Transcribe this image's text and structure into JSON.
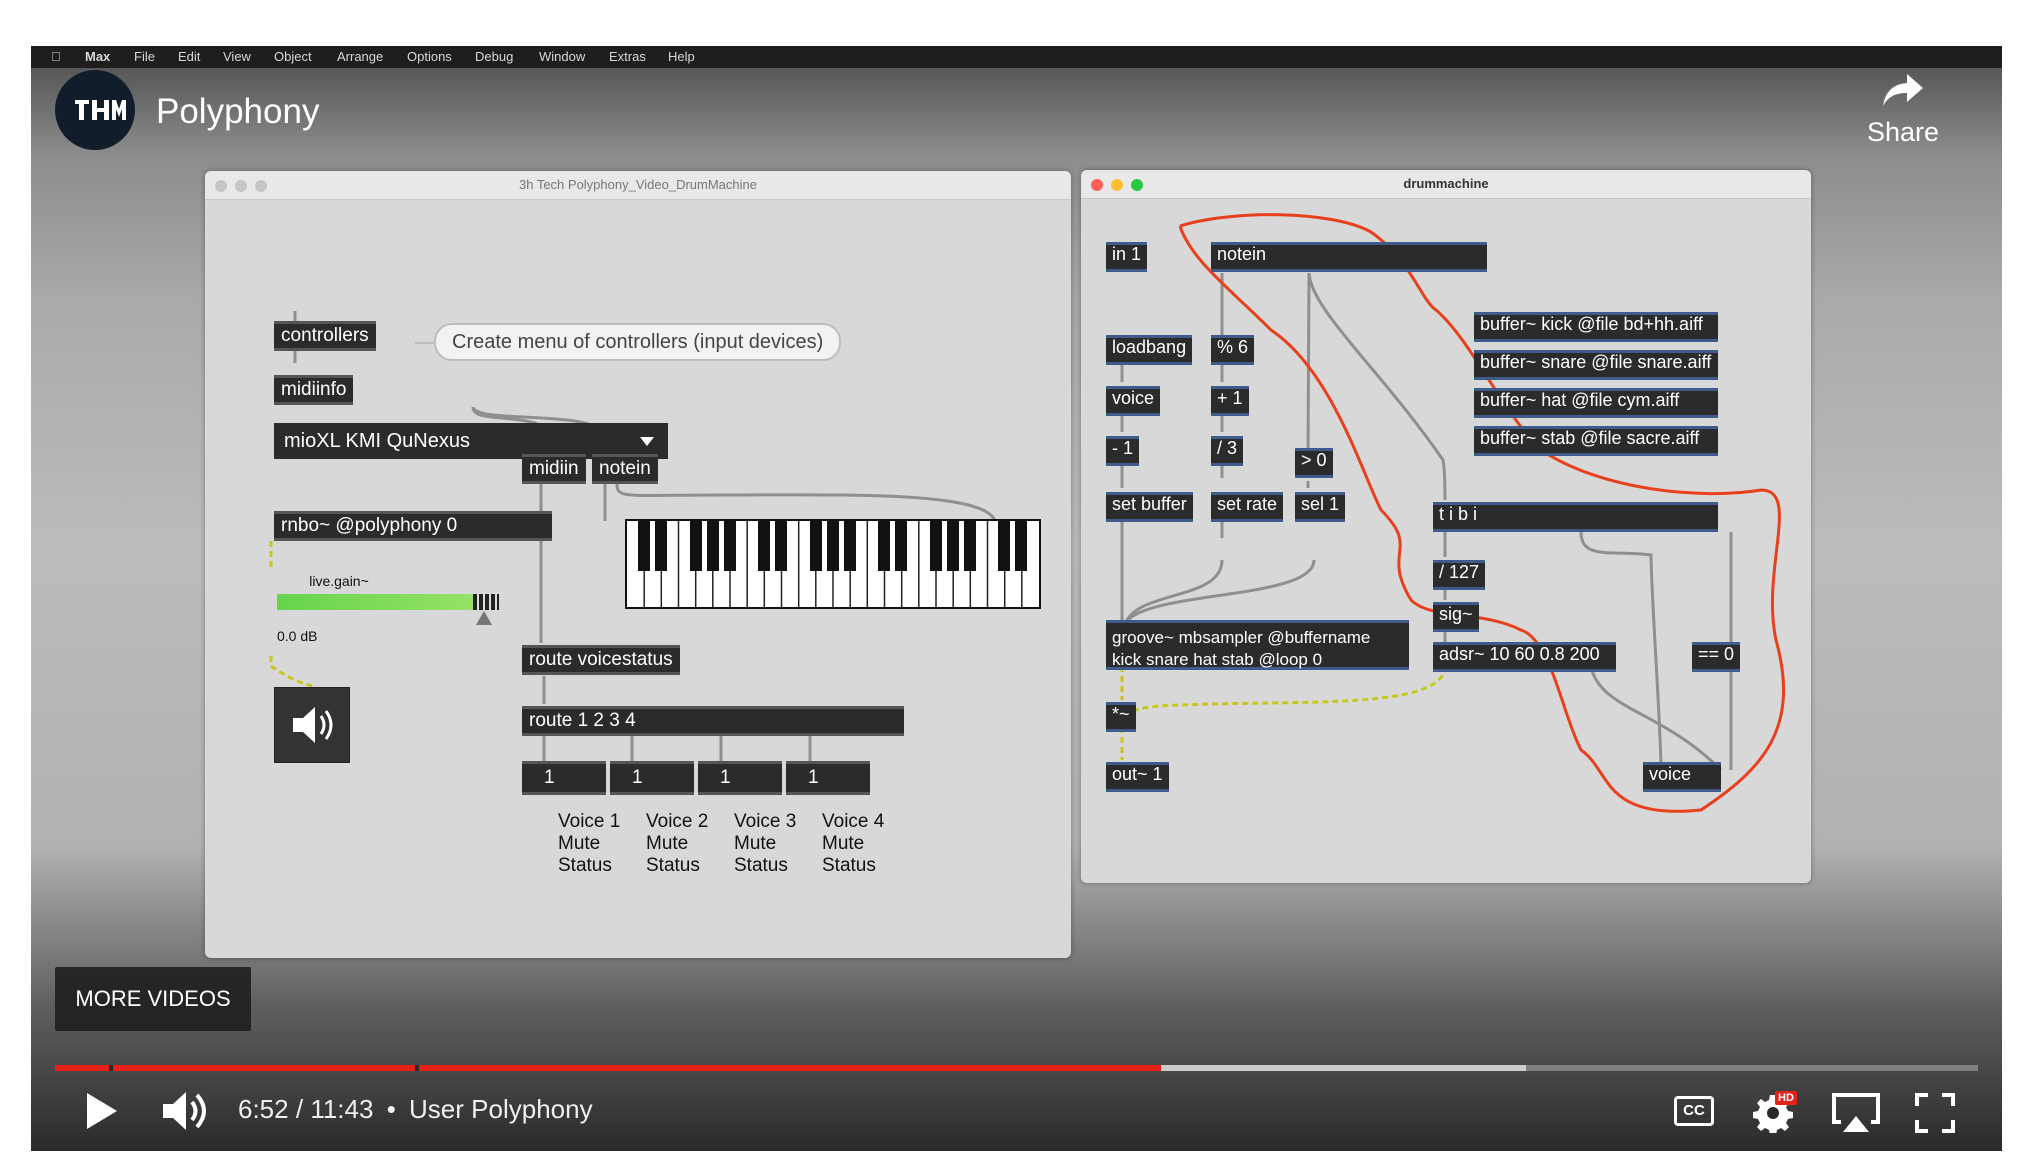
{
  "video": {
    "title": "Polyphony",
    "share_label": "Share",
    "more_videos_label": "MORE VIDEOS",
    "time_current": "6:52",
    "time_total": "11:43",
    "time_separator": "/",
    "chapter_separator": "•",
    "chapter_title": "User Polyphony",
    "played_fraction": 0.575,
    "buffered_fraction": 0.765,
    "hd_badge": "HD",
    "cc_label": "CC"
  },
  "menubar": [
    "Max",
    "File",
    "Edit",
    "View",
    "Object",
    "Arrange",
    "Options",
    "Debug",
    "Window",
    "Extras",
    "Help"
  ],
  "left_window": {
    "title": "3h Tech Polyphony_Video_DrumMachine",
    "controllers": "controllers",
    "comment": "Create menu of controllers (input devices)",
    "midiinfo": "midiinfo",
    "menu_value": "mioXL KMI QuNexus",
    "midiin": "midiin",
    "notein": "notein",
    "rnbo": "rnbo~ @polyphony 0",
    "gain_label": "live.gain~",
    "gain_value": "0.0 dB",
    "route_voicestatus": "route voicestatus",
    "route_1234": "route 1 2 3 4",
    "number_values": [
      "1",
      "1",
      "1",
      "1"
    ],
    "voice_labels": [
      [
        "Voice 1",
        "Mute",
        "Status"
      ],
      [
        "Voice 2",
        "Mute",
        "Status"
      ],
      [
        "Voice 3",
        "Mute",
        "Status"
      ],
      [
        "Voice 4",
        "Mute",
        "Status"
      ]
    ]
  },
  "right_window": {
    "title": "drummachine",
    "in1": "in 1",
    "notein": "notein",
    "loadbang": "loadbang",
    "mod6": "% 6",
    "voice": "voice",
    "plus1": "+ 1",
    "minus1": "- 1",
    "div3": "/ 3",
    "gt0": "> 0",
    "set_buffer": "set buffer",
    "set_rate": "set rate",
    "sel1": "sel 1",
    "buffers": [
      "buffer~ kick @file bd+hh.aiff",
      "buffer~ snare @file snare.aiff",
      "buffer~ hat @file cym.aiff",
      "buffer~ stab @file sacre.aiff"
    ],
    "tbi": "t i b i",
    "div127": "/ 127",
    "sig": "sig~",
    "groove_line1": "groove~ mbsampler @buffername",
    "groove_line2": "kick snare hat stab @loop 0",
    "adsr": "adsr~ 10 60 0.8 200",
    "eq0": "== 0",
    "mult": "*~",
    "out1": "out~ 1",
    "voice_out": "voice"
  },
  "colors": {
    "progress_played": "#e62117",
    "annotation": "#e8401c",
    "patch_cord_signal": "#c7c720"
  }
}
